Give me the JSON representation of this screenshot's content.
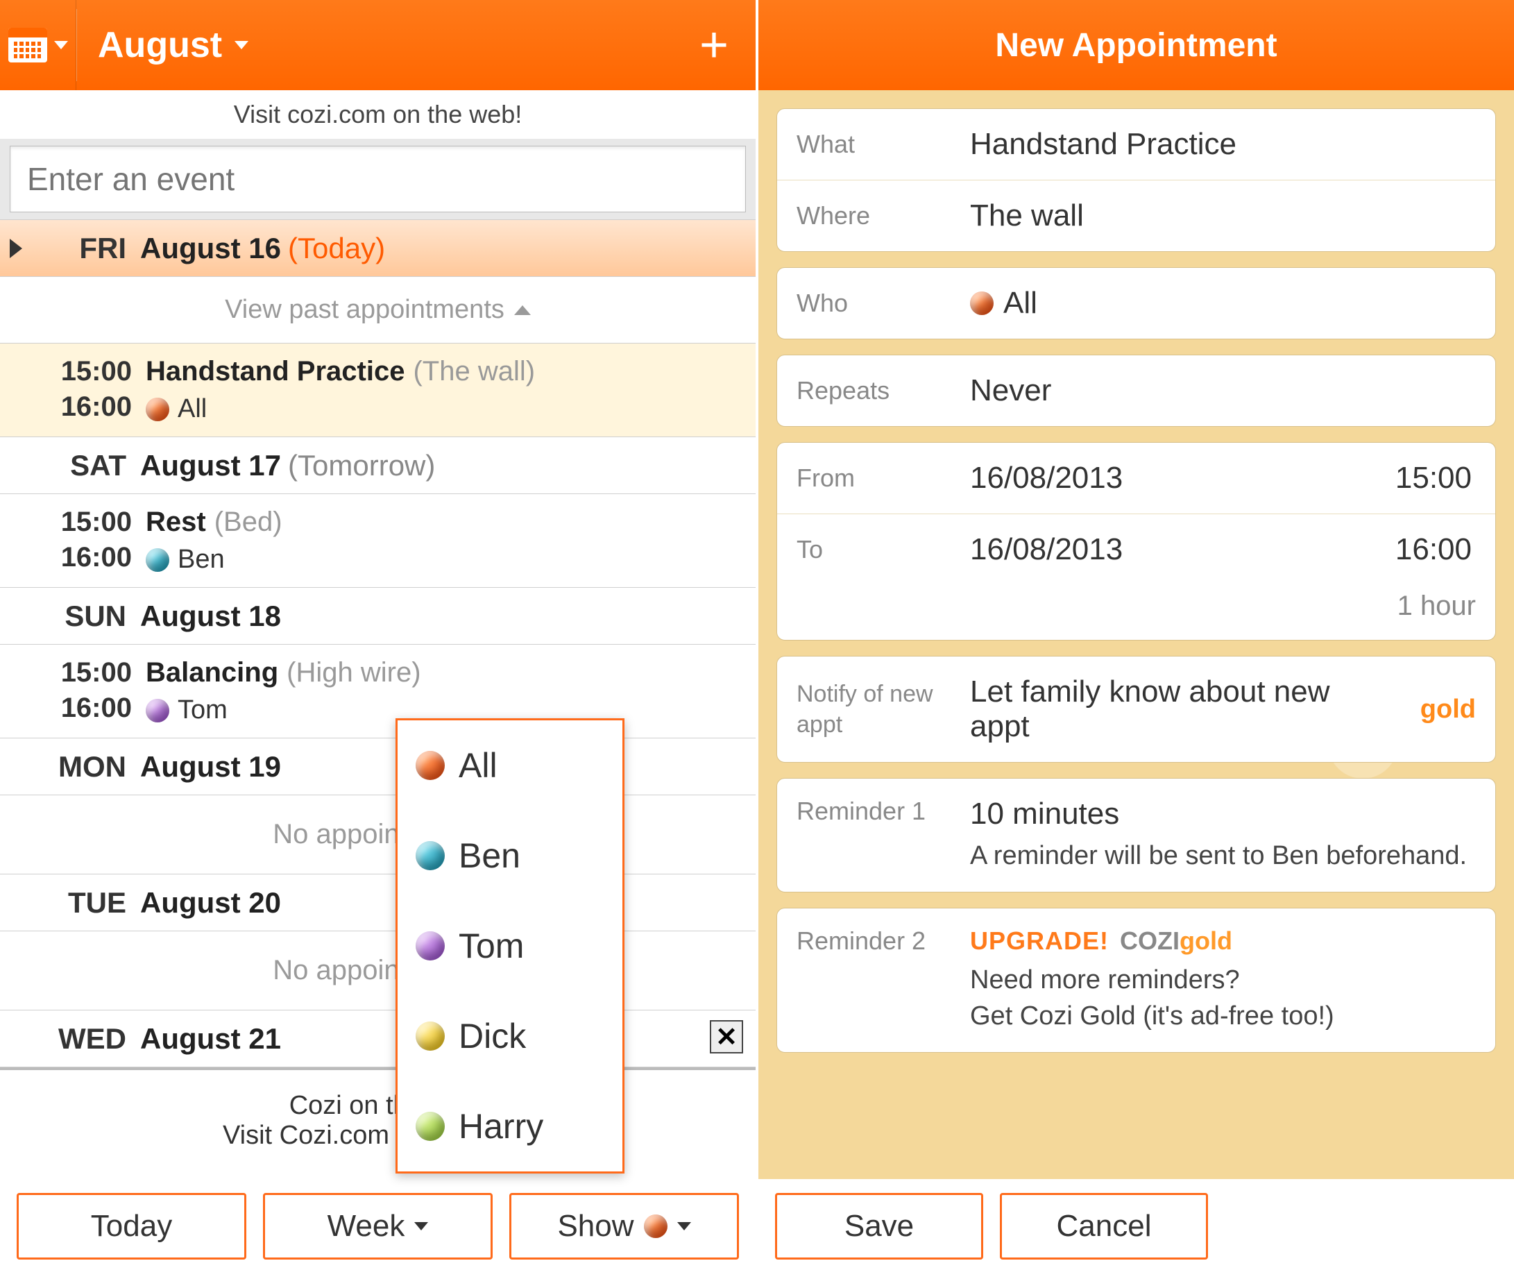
{
  "left": {
    "month": "August",
    "promo": "Visit cozi.com on the web!",
    "event_placeholder": "Enter an event",
    "view_past": "View past appointments",
    "days": {
      "fri": {
        "dow": "FRI",
        "date": "August 16",
        "suffix": "(Today)"
      },
      "sat": {
        "dow": "SAT",
        "date": "August 17",
        "suffix": "(Tomorrow)"
      },
      "sun": {
        "dow": "SUN",
        "date": "August 18"
      },
      "mon": {
        "dow": "MON",
        "date": "August 19"
      },
      "tue": {
        "dow": "TUE",
        "date": "August 20"
      },
      "wed": {
        "dow": "WED",
        "date": "August 21"
      }
    },
    "appts": {
      "fri": {
        "start": "15:00",
        "end": "16:00",
        "title": "Handstand Practice",
        "loc": "(The wall)",
        "who": "All"
      },
      "sat": {
        "start": "15:00",
        "end": "16:00",
        "title": "Rest",
        "loc": "(Bed)",
        "who": "Ben"
      },
      "sun": {
        "start": "15:00",
        "end": "16:00",
        "title": "Balancing",
        "loc": "(High wire)",
        "who": "Tom"
      }
    },
    "no_appt": "No appointments",
    "ad_line1": "Cozi on the go!",
    "ad_line2": "Visit Cozi.com on the web!",
    "bottom": {
      "today": "Today",
      "week": "Week",
      "show": "Show"
    },
    "popup": {
      "all": "All",
      "ben": "Ben",
      "tom": "Tom",
      "dick": "Dick",
      "harry": "Harry"
    }
  },
  "right": {
    "title": "New Appointment",
    "labels": {
      "what": "What",
      "where": "Where",
      "who": "Who",
      "repeats": "Repeats",
      "from": "From",
      "to": "To",
      "notify": "Notify of new appt",
      "rem1": "Reminder 1",
      "rem2": "Reminder 2"
    },
    "values": {
      "what": "Handstand Practice",
      "where": "The wall",
      "who": "All",
      "repeats": "Never",
      "from_date": "16/08/2013",
      "from_time": "15:00",
      "to_date": "16/08/2013",
      "to_time": "16:00",
      "duration": "1 hour",
      "notify": "Let family know about new appt",
      "gold_badge": "gold",
      "rem1": "10 minutes",
      "rem1_sub": "A reminder will be sent to Ben beforehand.",
      "upgrade": "UPGRADE!",
      "rem2_line1": "Need more reminders?",
      "rem2_line2": "Get Cozi Gold (it's ad-free too!)"
    },
    "buttons": {
      "save": "Save",
      "cancel": "Cancel"
    }
  }
}
